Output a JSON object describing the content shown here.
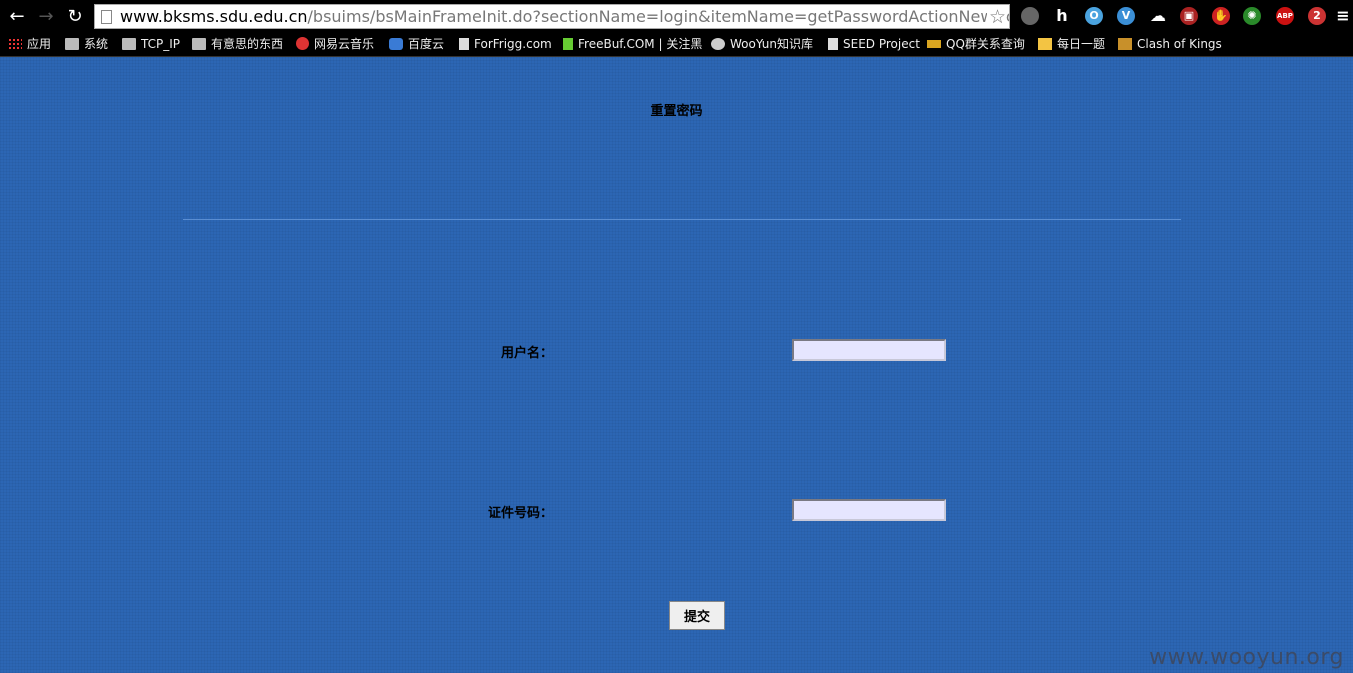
{
  "browser": {
    "url_host": "www.bksms.sdu.edu.cn",
    "url_path": "/bsuims/bsMainFrameInit.do?sectionName=login&itemName=getPasswordActionNew&controlType=",
    "bookmarks": [
      {
        "label": "应用",
        "icon": "apps-icon"
      },
      {
        "label": "系统",
        "icon": "folder-icon"
      },
      {
        "label": "TCP_IP",
        "icon": "folder-icon"
      },
      {
        "label": "有意思的东西",
        "icon": "folder-icon"
      },
      {
        "label": "网易云音乐",
        "icon": "netease-music-icon"
      },
      {
        "label": "百度云",
        "icon": "baidu-cloud-icon"
      },
      {
        "label": "ForFrigg.com",
        "icon": "page-icon"
      },
      {
        "label": "FreeBuf.COM | 关注黑",
        "icon": "freebuf-icon"
      },
      {
        "label": "WooYun知识库",
        "icon": "wooyun-icon"
      },
      {
        "label": "SEED Project",
        "icon": "page-icon"
      },
      {
        "label": "QQ群关系查询",
        "icon": "key-icon"
      },
      {
        "label": "每日一题",
        "icon": "mail-icon"
      },
      {
        "label": "Clash of Kings",
        "icon": "game-icon"
      }
    ],
    "extensions": [
      {
        "name": "clock-icon",
        "text": "",
        "color": "#666666"
      },
      {
        "name": "h-icon",
        "text": "h",
        "color": "#000000"
      },
      {
        "name": "circle-o-icon",
        "text": "O",
        "color": "#4aa3df"
      },
      {
        "name": "vimeo-icon",
        "text": "V",
        "color": "#3b8fd6"
      },
      {
        "name": "cloud-icon",
        "text": "☁",
        "color": "#000000"
      },
      {
        "name": "mask-icon",
        "text": "▣",
        "color": "#aa2222"
      },
      {
        "name": "stop-hand-icon",
        "text": "✋",
        "color": "#cc2222"
      },
      {
        "name": "plant-icon",
        "text": "✺",
        "color": "#2a8a2a"
      },
      {
        "name": "adblock-plus-icon",
        "text": "ABP",
        "color": "#cc1111"
      },
      {
        "name": "notification-icon",
        "text": "2",
        "color": "#cc3333"
      },
      {
        "name": "menu-icon",
        "text": "≡",
        "color": "#000000"
      }
    ]
  },
  "page": {
    "title": "重置密码",
    "username_label": "用户名：",
    "id_number_label": "证件号码：",
    "username_value": "",
    "id_number_value": "",
    "submit_label": "提交",
    "watermark": "www.wooyun.org"
  }
}
